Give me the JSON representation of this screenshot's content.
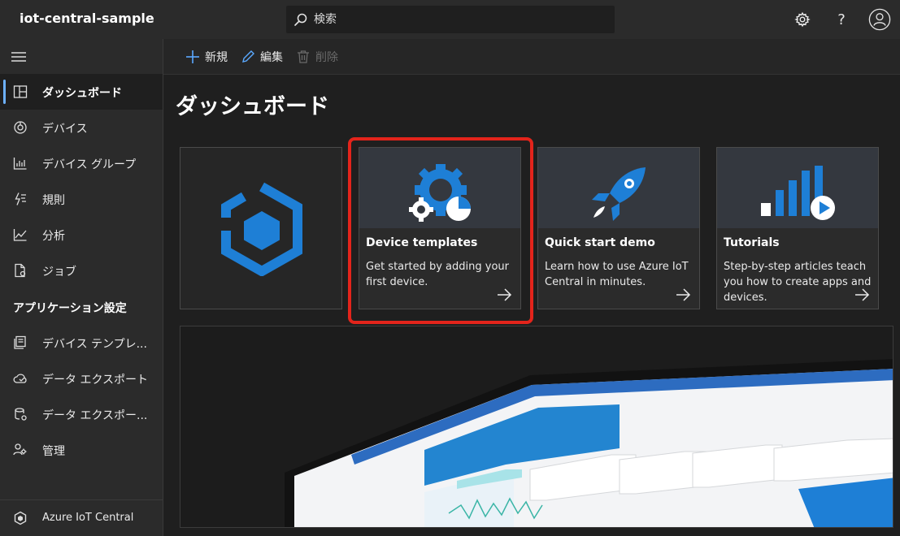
{
  "app": {
    "title": "iot-central-sample"
  },
  "search": {
    "placeholder": "検索"
  },
  "topbar": {
    "settings_icon": "gear-icon",
    "help_label": "?",
    "account_icon": "user-icon"
  },
  "sidebar": {
    "items": [
      {
        "label": "ダッシュボード",
        "icon": "dashboard-icon",
        "selected": true
      },
      {
        "label": "デバイス",
        "icon": "devices-icon"
      },
      {
        "label": "デバイス グループ",
        "icon": "device-groups-icon"
      },
      {
        "label": "規則",
        "icon": "rules-icon"
      },
      {
        "label": "分析",
        "icon": "analytics-icon"
      },
      {
        "label": "ジョブ",
        "icon": "jobs-icon"
      }
    ],
    "section_header": "アプリケーション設定",
    "settings_items": [
      {
        "label": "デバイス テンプレ...",
        "icon": "device-templates-icon"
      },
      {
        "label": "データ エクスポート",
        "icon": "data-export-icon"
      },
      {
        "label": "データ エクスポー...",
        "icon": "data-export-legacy-icon"
      },
      {
        "label": "管理",
        "icon": "administration-icon"
      }
    ],
    "footer": {
      "label": "Azure IoT Central",
      "icon": "iot-central-logo-icon"
    }
  },
  "commands": {
    "new_label": "新規",
    "edit_label": "編集",
    "delete_label": "削除"
  },
  "main": {
    "title": "ダッシュボード",
    "tiles": [
      {
        "title": "Device templates",
        "description": "Get started by adding your first device.",
        "icon": "device-templates-gear-icon"
      },
      {
        "title": "Quick start demo",
        "description": "Learn how to use Azure IoT Central in minutes.",
        "icon": "rocket-icon"
      },
      {
        "title": "Tutorials",
        "description": "Step-by-step articles teach you how to create apps and devices.",
        "icon": "tutorials-chart-icon"
      }
    ]
  },
  "colors": {
    "accent": "#1e8be6",
    "selection_bar": "#6db1ff",
    "highlight": "#e3241b",
    "background": "#1f1f1f",
    "panel": "#2b2b2b"
  }
}
